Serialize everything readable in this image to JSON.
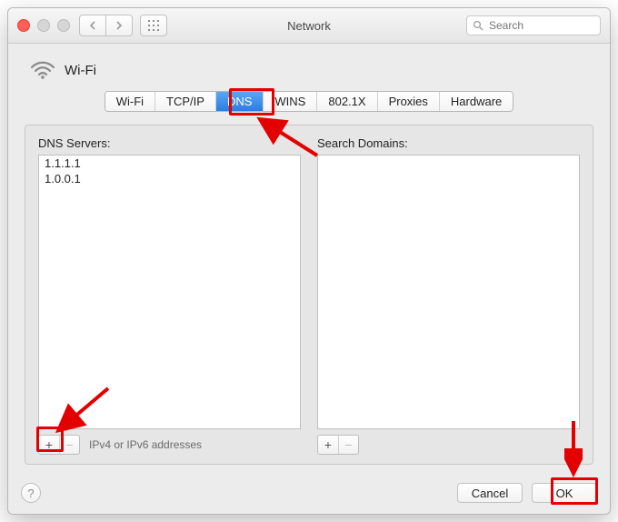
{
  "window": {
    "title": "Network"
  },
  "search": {
    "placeholder": "Search"
  },
  "connection": {
    "name": "Wi-Fi"
  },
  "tabs": [
    {
      "label": "Wi-Fi"
    },
    {
      "label": "TCP/IP"
    },
    {
      "label": "DNS"
    },
    {
      "label": "WINS"
    },
    {
      "label": "802.1X"
    },
    {
      "label": "Proxies"
    },
    {
      "label": "Hardware"
    }
  ],
  "dns": {
    "servers_label": "DNS Servers:",
    "servers": [
      "1.1.1.1",
      "1.0.0.1"
    ],
    "footer_hint": "IPv4 or IPv6 addresses"
  },
  "domains": {
    "label": "Search Domains:",
    "items": []
  },
  "buttons": {
    "cancel": "Cancel",
    "ok": "OK"
  },
  "glyphs": {
    "plus": "+",
    "minus": "−",
    "help": "?"
  }
}
